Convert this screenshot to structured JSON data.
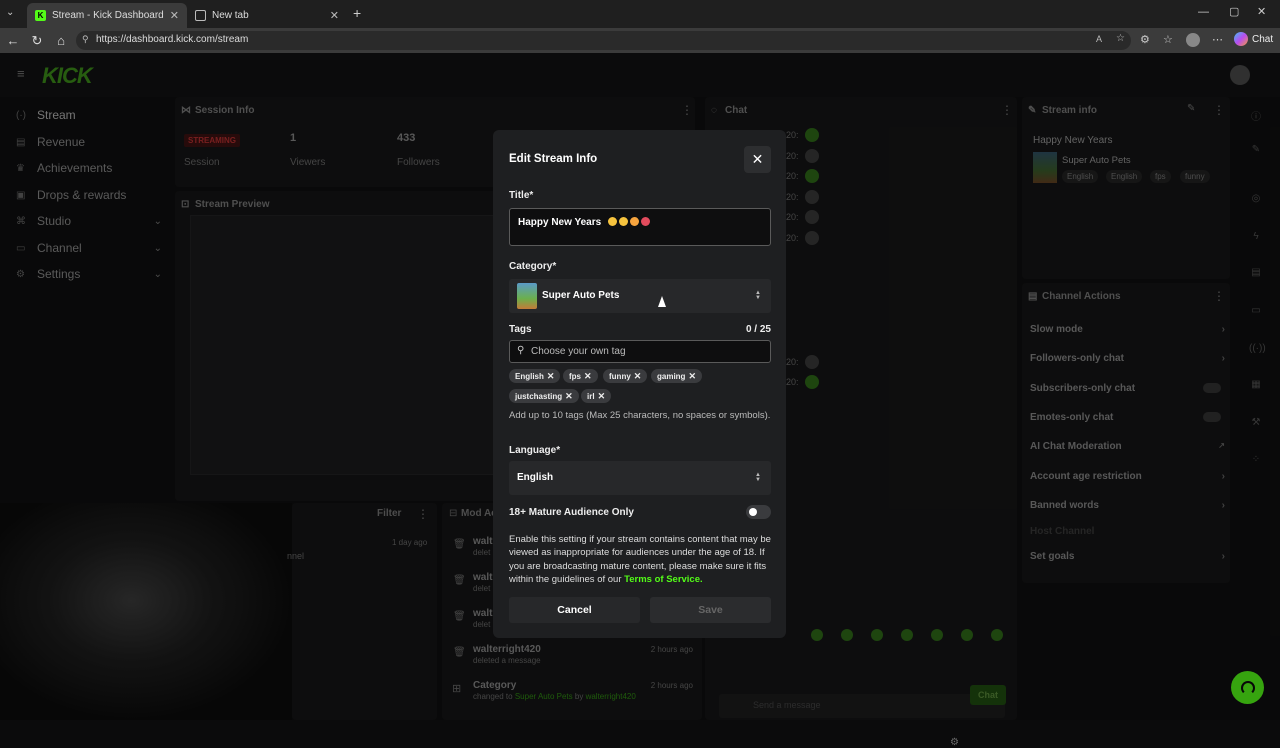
{
  "browser": {
    "tabs": [
      {
        "title": "Stream - Kick Dashboard",
        "favicon": "K"
      },
      {
        "title": "New tab"
      }
    ],
    "url": "https://dashboard.kick.com/stream",
    "chat_button": "Chat"
  },
  "app": {
    "logo": "KICK",
    "sidebar": [
      {
        "label": "Stream",
        "icon": "stream-icon"
      },
      {
        "label": "Revenue",
        "icon": "revenue-icon"
      },
      {
        "label": "Achievements",
        "icon": "trophy-icon"
      },
      {
        "label": "Drops & rewards",
        "icon": "gift-icon"
      },
      {
        "label": "Studio",
        "icon": "studio-icon"
      },
      {
        "label": "Channel",
        "icon": "channel-icon"
      },
      {
        "label": "Settings",
        "icon": "gear-icon"
      }
    ],
    "session_info": {
      "title": "Session Info",
      "status": "STREAMING",
      "status_label": "Session",
      "viewers_value": "1",
      "viewers_label": "Viewers",
      "followers_value": "433",
      "followers_label": "Followers"
    },
    "stream_preview": {
      "title": "Stream Preview"
    },
    "chat": {
      "title": "Chat",
      "time_prefix": "20:",
      "input_placeholder": "Send a message",
      "send_label": "Chat"
    },
    "stream_info": {
      "title": "Stream info",
      "stream_title": "Happy New Years",
      "category": "Super Auto Pets",
      "tags": [
        "English",
        "English",
        "fps",
        "funny"
      ]
    },
    "channel_actions": {
      "title": "Channel Actions",
      "items": [
        "Slow mode",
        "Followers-only chat",
        "Subscribers-only chat",
        "Emotes-only chat",
        "AI Chat Moderation",
        "Account age restriction",
        "Banned words",
        "Host Channel",
        "Set goals"
      ]
    },
    "activity": {
      "filter": "Filter",
      "header_left": "nnel",
      "header_right": "Mod Ac",
      "time_1": "1 day ago",
      "rows": [
        {
          "user": "walt",
          "action": "delet"
        },
        {
          "user": "walt",
          "action": "delet"
        },
        {
          "user": "walt",
          "action": "delet"
        },
        {
          "user": "walterright420",
          "action": "deleted a message",
          "time": "2 hours ago"
        },
        {
          "user": "Category",
          "action": "changed to",
          "target": "Super Auto Pets",
          "by": "by",
          "actor": "walterright420",
          "time": "2 hours ago"
        }
      ]
    }
  },
  "modal": {
    "title": "Edit Stream Info",
    "title_label": "Title*",
    "title_value": "Happy New Years",
    "category_label": "Category*",
    "category_value": "Super Auto Pets",
    "tags_label": "Tags",
    "tags_count": "0 / 25",
    "tag_placeholder": "Choose your own tag",
    "tags": [
      "English",
      "fps",
      "funny",
      "gaming",
      "justchasting",
      "irl"
    ],
    "tags_hint": "Add up to 10 tags (Max 25 characters, no spaces or symbols).",
    "language_label": "Language*",
    "language_value": "English",
    "mature_label": "18+ Mature Audience Only",
    "mature_enabled": false,
    "mature_desc": "Enable this setting if your stream contains content that may be viewed as inappropriate for audiences under the age of 18. If you are broadcasting mature content, please make sure it fits within the guidelines of our",
    "tos_link": "Terms of Service.",
    "cancel": "Cancel",
    "save": "Save"
  },
  "colors": {
    "accent": "#53fc18",
    "streaming": "#e02424"
  }
}
